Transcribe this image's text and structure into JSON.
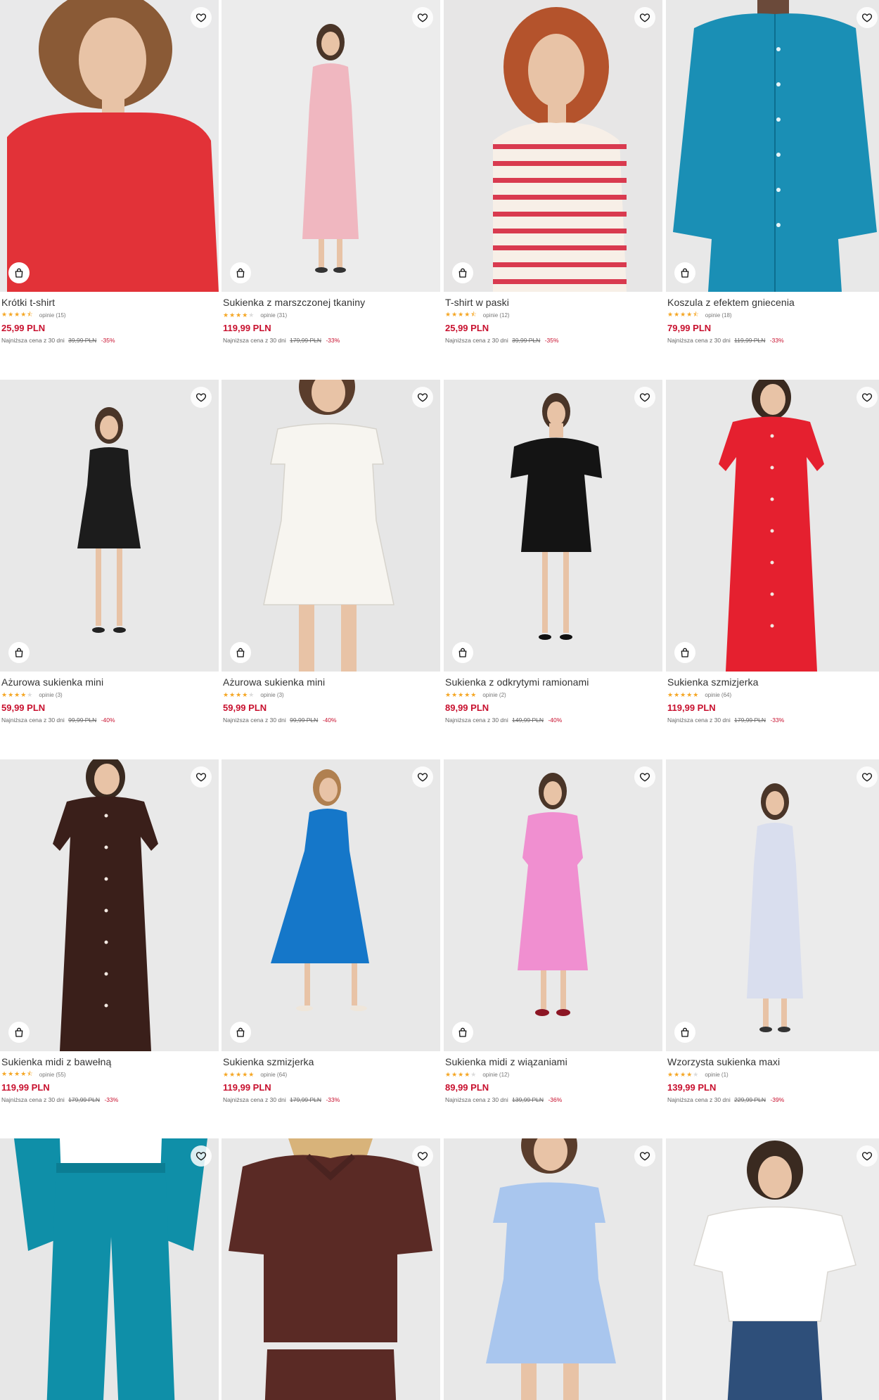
{
  "products": [
    {
      "name": "Krótki t-shirt",
      "stars": 4.5,
      "reviews": "opinie (15)",
      "price": "25,99 PLN",
      "lowest_label": "Najniższa cena z 30 dni",
      "old_price": "39,99 PLN",
      "discount": "-35%",
      "bg": "#e9e9ea",
      "color": "#e23238",
      "kind": "tee-close"
    },
    {
      "name": "Sukienka z marszczonej tkaniny",
      "stars": 4,
      "reviews": "opinie (31)",
      "price": "119,99 PLN",
      "lowest_label": "Najniższa cena z 30 dni",
      "old_price": "179,99 PLN",
      "discount": "-33%",
      "bg": "#ececec",
      "color": "#f0b7c0",
      "kind": "maxi"
    },
    {
      "name": "T-shirt w paski",
      "stars": 4.5,
      "reviews": "opinie (12)",
      "price": "25,99 PLN",
      "lowest_label": "Najniższa cena z 30 dni",
      "old_price": "39,99 PLN",
      "discount": "-35%",
      "bg": "#e7e6e6",
      "color": "#d93a4f",
      "kind": "tee-stripe"
    },
    {
      "name": "Koszula z efektem gniecenia",
      "stars": 4.5,
      "reviews": "opinie (18)",
      "price": "79,99 PLN",
      "lowest_label": "Najniższa cena z 30 dni",
      "old_price": "119,99 PLN",
      "discount": "-33%",
      "bg": "#e8e8e8",
      "color": "#1a8fb5",
      "kind": "shirt"
    },
    {
      "name": "Ażurowa sukienka mini",
      "stars": 4,
      "reviews": "opinie (3)",
      "price": "59,99 PLN",
      "lowest_label": "Najniższa cena z 30 dni",
      "old_price": "99,99 PLN",
      "discount": "-40%",
      "bg": "#e8e8e8",
      "color": "#1c1c1c",
      "kind": "mini"
    },
    {
      "name": "Ażurowa sukienka mini",
      "stars": 4,
      "reviews": "opinie (3)",
      "price": "59,99 PLN",
      "lowest_label": "Najniższa cena z 30 dni",
      "old_price": "99,99 PLN",
      "discount": "-40%",
      "bg": "#e6e6e6",
      "color": "#f7f5f0",
      "kind": "mini-close"
    },
    {
      "name": "Sukienka z odkrytymi ramionami",
      "stars": 5,
      "reviews": "opinie (2)",
      "price": "89,99 PLN",
      "lowest_label": "Najniższa cena z 30 dni",
      "old_price": "149,99 PLN",
      "discount": "-40%",
      "bg": "#e9e9e9",
      "color": "#141414",
      "kind": "mini-off"
    },
    {
      "name": "Sukienka szmizjerka",
      "stars": 5,
      "reviews": "opinie (64)",
      "price": "119,99 PLN",
      "lowest_label": "Najniższa cena z 30 dni",
      "old_price": "179,99 PLN",
      "discount": "-33%",
      "bg": "#e8e8e8",
      "color": "#e5202f",
      "kind": "maxi-close"
    },
    {
      "name": "Sukienka midi z bawełną",
      "stars": 4.5,
      "reviews": "opinie (55)",
      "price": "119,99 PLN",
      "lowest_label": "Najniższa cena z 30 dni",
      "old_price": "179,99 PLN",
      "discount": "-33%",
      "bg": "#e9e9e9",
      "color": "#3a1f1a",
      "kind": "maxi-close"
    },
    {
      "name": "Sukienka szmizjerka",
      "stars": 5,
      "reviews": "opinie (64)",
      "price": "119,99 PLN",
      "lowest_label": "Najniższa cena z 30 dni",
      "old_price": "179,99 PLN",
      "discount": "-33%",
      "bg": "#e8e8e8",
      "color": "#1577c9",
      "kind": "midi-walk"
    },
    {
      "name": "Sukienka midi z wiązaniami",
      "stars": 4,
      "reviews": "opinie (12)",
      "price": "89,99 PLN",
      "lowest_label": "Najniższa cena z 30 dni",
      "old_price": "139,99 PLN",
      "discount": "-36%",
      "bg": "#e9e9e9",
      "color": "#f08fd0",
      "kind": "midi"
    },
    {
      "name": "Wzorzysta sukienka maxi",
      "stars": 4,
      "reviews": "opinie (1)",
      "price": "139,99 PLN",
      "lowest_label": "Najniższa cena z 30 dni",
      "old_price": "229,99 PLN",
      "discount": "-39%",
      "bg": "#ebebeb",
      "color": "#d9deee",
      "kind": "maxi"
    },
    {
      "name": "",
      "stars": 0,
      "reviews": "",
      "price": "",
      "lowest_label": "",
      "old_price": "",
      "discount": "",
      "bg": "#e7e7e7",
      "color": "#0f8fa8",
      "kind": "pants"
    },
    {
      "name": "",
      "stars": 0,
      "reviews": "",
      "price": "",
      "lowest_label": "",
      "old_price": "",
      "discount": "",
      "bg": "#e9e9e9",
      "color": "#5a2a25",
      "kind": "polo"
    },
    {
      "name": "",
      "stars": 0,
      "reviews": "",
      "price": "",
      "lowest_label": "",
      "old_price": "",
      "discount": "",
      "bg": "#e8e8e8",
      "color": "#a9c6ee",
      "kind": "mini-close"
    },
    {
      "name": "",
      "stars": 0,
      "reviews": "",
      "price": "",
      "lowest_label": "",
      "old_price": "",
      "discount": "",
      "bg": "#ececec",
      "color": "#ffffff",
      "kind": "ruffle-tee"
    }
  ]
}
